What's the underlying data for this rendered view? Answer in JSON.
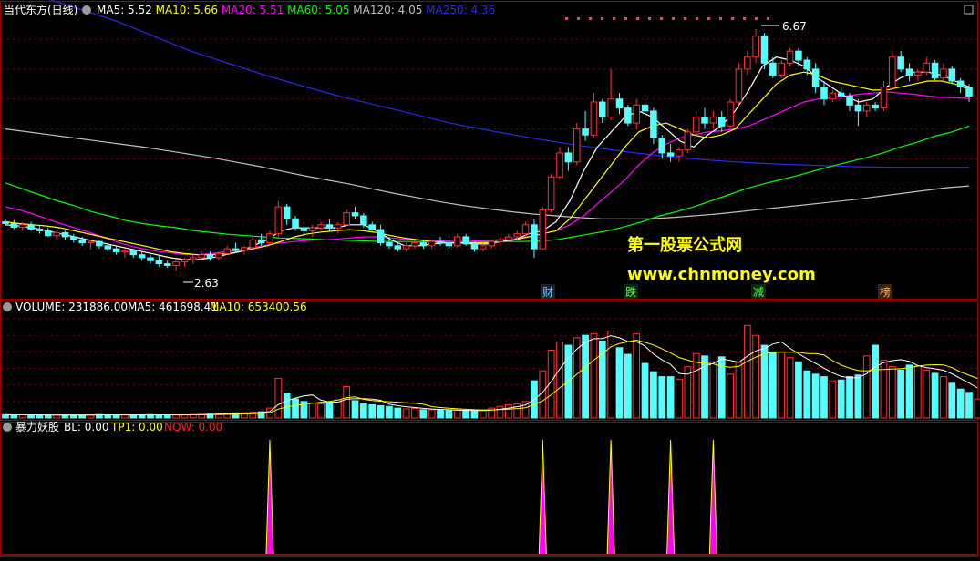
{
  "colors": {
    "up": "#ff3232",
    "down": "#54ffff",
    "ma5": "#ffffff",
    "ma10": "#ffff00",
    "ma20": "#ff00ff",
    "ma60": "#00ff00",
    "ma120": "#c0c0c0",
    "ma250": "#2a2ae6",
    "grid": "#7a0000",
    "border": "#9b0000",
    "watermark": "#ffff00"
  },
  "header": {
    "title": "当代东方(日线)",
    "ma": [
      {
        "label": "MA5: 5.52",
        "color": "#ffffff"
      },
      {
        "label": "MA10: 5.66",
        "color": "#ffff00"
      },
      {
        "label": "MA20: 5.51",
        "color": "#ff00ff"
      },
      {
        "label": "MA60: 5.05",
        "color": "#00ff00"
      },
      {
        "label": "MA120: 4.05",
        "color": "#c0c0c0"
      },
      {
        "label": "MA250: 4.36",
        "color": "#2a2ae6"
      }
    ]
  },
  "annotations": {
    "high": "6.67",
    "low": "2.63",
    "tags": [
      "财",
      "跌",
      "减",
      "榜"
    ]
  },
  "watermark": {
    "line1": "第一股票公式网",
    "line2": "www.chnmoney.com"
  },
  "volume_header": {
    "label": "VOLUME: 231886.00",
    "ma5": "MA5: 461698.41",
    "ma10": "MA10: 653400.56"
  },
  "ind_header": {
    "label": "暴力妖股",
    "bl": "BL: 0.00",
    "tp1": "TP1: 0.00",
    "nqw": "NQW: 0.00"
  },
  "chart_data": [
    {
      "type": "candlestick",
      "title": "当代东方(日线)",
      "ohlc": [
        [
          3.45,
          3.5,
          3.38,
          3.42
        ],
        [
          3.42,
          3.48,
          3.33,
          3.36
        ],
        [
          3.36,
          3.44,
          3.3,
          3.4
        ],
        [
          3.4,
          3.45,
          3.3,
          3.33
        ],
        [
          3.33,
          3.38,
          3.25,
          3.3
        ],
        [
          3.3,
          3.35,
          3.2,
          3.22
        ],
        [
          3.22,
          3.3,
          3.15,
          3.27
        ],
        [
          3.27,
          3.3,
          3.15,
          3.2
        ],
        [
          3.2,
          3.25,
          3.1,
          3.15
        ],
        [
          3.15,
          3.2,
          3.05,
          3.1
        ],
        [
          3.1,
          3.15,
          3.0,
          3.12
        ],
        [
          3.12,
          3.15,
          3.0,
          3.05
        ],
        [
          3.05,
          3.1,
          2.95,
          3.0
        ],
        [
          3.0,
          3.05,
          2.9,
          2.95
        ],
        [
          2.95,
          3.0,
          2.85,
          2.97
        ],
        [
          2.97,
          3.0,
          2.85,
          2.9
        ],
        [
          2.9,
          2.95,
          2.8,
          2.85
        ],
        [
          2.85,
          2.9,
          2.75,
          2.8
        ],
        [
          2.8,
          2.9,
          2.7,
          2.75
        ],
        [
          2.75,
          2.8,
          2.68,
          2.72
        ],
        [
          2.72,
          2.8,
          2.63,
          2.78
        ],
        [
          2.78,
          2.85,
          2.7,
          2.82
        ],
        [
          2.82,
          2.9,
          2.75,
          2.85
        ],
        [
          2.85,
          2.95,
          2.8,
          2.9
        ],
        [
          2.9,
          2.95,
          2.8,
          2.85
        ],
        [
          2.85,
          2.95,
          2.8,
          2.92
        ],
        [
          2.92,
          3.05,
          2.9,
          3.0
        ],
        [
          3.0,
          3.1,
          2.95,
          2.97
        ],
        [
          2.97,
          3.05,
          2.9,
          3.02
        ],
        [
          3.02,
          3.2,
          3.0,
          3.15
        ],
        [
          3.15,
          3.25,
          3.05,
          3.1
        ],
        [
          3.1,
          3.3,
          3.08,
          3.25
        ],
        [
          3.25,
          3.8,
          3.2,
          3.7
        ],
        [
          3.7,
          3.75,
          3.4,
          3.5
        ],
        [
          3.5,
          3.55,
          3.3,
          3.35
        ],
        [
          3.35,
          3.45,
          3.25,
          3.3
        ],
        [
          3.3,
          3.4,
          3.2,
          3.35
        ],
        [
          3.35,
          3.45,
          3.3,
          3.4
        ],
        [
          3.4,
          3.5,
          3.3,
          3.35
        ],
        [
          3.35,
          3.45,
          3.25,
          3.4
        ],
        [
          3.4,
          3.65,
          3.38,
          3.6
        ],
        [
          3.6,
          3.7,
          3.5,
          3.55
        ],
        [
          3.55,
          3.6,
          3.35,
          3.4
        ],
        [
          3.4,
          3.45,
          3.3,
          3.32
        ],
        [
          3.32,
          3.4,
          3.05,
          3.1
        ],
        [
          3.1,
          3.2,
          3.0,
          3.05
        ],
        [
          3.05,
          3.1,
          2.95,
          3.0
        ],
        [
          3.0,
          3.1,
          2.95,
          3.05
        ],
        [
          3.05,
          3.15,
          3.0,
          3.1
        ],
        [
          3.1,
          3.15,
          3.0,
          3.05
        ],
        [
          3.05,
          3.15,
          3.0,
          3.12
        ],
        [
          3.12,
          3.2,
          3.05,
          3.1
        ],
        [
          3.1,
          3.15,
          3.0,
          3.05
        ],
        [
          3.05,
          3.25,
          3.02,
          3.2
        ],
        [
          3.2,
          3.25,
          3.05,
          3.08
        ],
        [
          3.08,
          3.12,
          2.95,
          3.0
        ],
        [
          3.0,
          3.1,
          2.95,
          3.05
        ],
        [
          3.05,
          3.15,
          3.0,
          3.12
        ],
        [
          3.12,
          3.2,
          3.05,
          3.15
        ],
        [
          3.15,
          3.25,
          3.1,
          3.2
        ],
        [
          3.2,
          3.3,
          3.15,
          3.25
        ],
        [
          3.25,
          3.45,
          3.2,
          3.4
        ],
        [
          3.4,
          3.5,
          2.85,
          3.0
        ],
        [
          3.0,
          3.7,
          2.98,
          3.65
        ],
        [
          3.65,
          4.25,
          3.6,
          4.2
        ],
        [
          4.2,
          4.7,
          4.15,
          4.6
        ],
        [
          4.6,
          4.7,
          4.3,
          4.45
        ],
        [
          4.45,
          5.1,
          4.4,
          5.0
        ],
        [
          5.0,
          5.3,
          4.8,
          4.9
        ],
        [
          4.9,
          5.6,
          4.85,
          5.45
        ],
        [
          5.45,
          5.5,
          5.1,
          5.2
        ],
        [
          5.2,
          6.0,
          5.15,
          5.5
        ],
        [
          5.5,
          5.6,
          5.25,
          5.35
        ],
        [
          5.35,
          5.4,
          5.05,
          5.1
        ],
        [
          5.1,
          5.5,
          5.0,
          5.4
        ],
        [
          5.4,
          5.5,
          5.2,
          5.3
        ],
        [
          5.3,
          5.35,
          4.75,
          4.85
        ],
        [
          4.85,
          4.9,
          4.5,
          4.6
        ],
        [
          4.6,
          4.75,
          4.45,
          4.55
        ],
        [
          4.55,
          4.7,
          4.45,
          4.65
        ],
        [
          4.65,
          5.0,
          4.6,
          4.95
        ],
        [
          4.95,
          5.3,
          4.9,
          5.2
        ],
        [
          5.2,
          5.35,
          5.0,
          5.1
        ],
        [
          5.1,
          5.3,
          5.0,
          5.2
        ],
        [
          5.2,
          5.3,
          4.95,
          5.05
        ],
        [
          5.05,
          5.5,
          5.0,
          5.45
        ],
        [
          5.45,
          6.1,
          5.4,
          6.0
        ],
        [
          6.0,
          6.3,
          5.9,
          6.2
        ],
        [
          6.2,
          6.67,
          6.1,
          6.55
        ],
        [
          6.55,
          6.6,
          6.0,
          6.1
        ],
        [
          6.1,
          6.2,
          5.85,
          5.9
        ],
        [
          5.9,
          6.15,
          5.85,
          6.1
        ],
        [
          6.1,
          6.35,
          6.05,
          6.3
        ],
        [
          6.3,
          6.35,
          6.05,
          6.15
        ],
        [
          6.15,
          6.2,
          5.9,
          6.0
        ],
        [
          6.0,
          6.1,
          5.6,
          5.7
        ],
        [
          5.7,
          5.8,
          5.4,
          5.5
        ],
        [
          5.5,
          5.65,
          5.45,
          5.6
        ],
        [
          5.6,
          5.7,
          5.5,
          5.55
        ],
        [
          5.55,
          5.6,
          5.3,
          5.4
        ],
        [
          5.4,
          5.5,
          5.05,
          5.3
        ],
        [
          5.3,
          5.45,
          5.2,
          5.4
        ],
        [
          5.4,
          5.45,
          5.3,
          5.35
        ],
        [
          5.35,
          5.8,
          5.3,
          5.7
        ],
        [
          5.7,
          6.3,
          5.65,
          6.2
        ],
        [
          6.2,
          6.3,
          5.95,
          6.0
        ],
        [
          6.0,
          6.1,
          5.8,
          5.9
        ],
        [
          5.9,
          6.0,
          5.8,
          5.95
        ],
        [
          5.95,
          6.2,
          5.9,
          6.1
        ],
        [
          6.1,
          6.15,
          5.8,
          5.85
        ],
        [
          5.85,
          6.1,
          5.8,
          6.0
        ],
        [
          6.0,
          6.05,
          5.75,
          5.8
        ],
        [
          5.8,
          5.85,
          5.6,
          5.7
        ],
        [
          5.7,
          5.75,
          5.45,
          5.55
        ]
      ],
      "y_ticks": [
        3.0,
        3.5,
        4.0,
        4.5,
        5.0,
        5.5,
        6.0,
        6.5
      ],
      "high_label": "6.67",
      "low_label": "2.63",
      "ma": {
        "MA5": [
          3.4,
          3.38,
          3.35,
          3.3,
          3.25,
          3.2,
          3.15,
          3.1,
          3.05,
          3.0,
          2.95,
          2.9,
          2.85,
          2.82,
          2.82,
          2.85,
          2.9,
          2.95,
          3.05,
          3.15,
          3.3,
          3.35,
          3.35,
          3.35,
          3.35,
          3.4,
          3.4,
          3.3,
          3.15,
          3.05,
          3.05,
          3.08,
          3.1,
          3.1,
          3.08,
          3.08,
          3.12,
          3.15,
          3.25,
          3.3,
          3.45,
          3.8,
          4.3,
          4.7,
          4.95,
          5.2,
          5.3,
          5.2,
          5.0,
          4.8,
          4.7,
          4.9,
          5.05,
          5.3,
          5.65,
          6.05,
          6.2,
          6.15,
          6.05,
          5.85,
          5.7,
          5.55,
          5.45,
          5.5,
          5.7,
          5.85,
          5.95,
          5.95,
          5.9,
          5.8,
          5.7
        ],
        "MA10": [
          3.45,
          3.42,
          3.4,
          3.38,
          3.35,
          3.3,
          3.25,
          3.2,
          3.15,
          3.1,
          3.05,
          3.0,
          2.95,
          2.92,
          2.9,
          2.9,
          2.92,
          2.95,
          3.0,
          3.05,
          3.12,
          3.2,
          3.25,
          3.28,
          3.3,
          3.32,
          3.3,
          3.27,
          3.22,
          3.18,
          3.15,
          3.12,
          3.1,
          3.1,
          3.1,
          3.1,
          3.12,
          3.15,
          3.2,
          3.25,
          3.3,
          3.5,
          3.8,
          4.1,
          4.4,
          4.7,
          4.95,
          5.05,
          5.1,
          5.0,
          4.9,
          4.85,
          4.9,
          5.0,
          5.25,
          5.5,
          5.75,
          5.9,
          5.95,
          5.9,
          5.8,
          5.75,
          5.7,
          5.65,
          5.65,
          5.7,
          5.75,
          5.8,
          5.8,
          5.75,
          5.66
        ],
        "MA20": [
          3.7,
          3.65,
          3.58,
          3.5,
          3.42,
          3.35,
          3.28,
          3.2,
          3.12,
          3.05,
          3.0,
          2.96,
          2.93,
          2.9,
          2.9,
          2.92,
          2.95,
          2.98,
          3.02,
          3.06,
          3.1,
          3.12,
          3.14,
          3.15,
          3.16,
          3.18,
          3.2,
          3.2,
          3.18,
          3.16,
          3.15,
          3.14,
          3.13,
          3.12,
          3.13,
          3.14,
          3.15,
          3.17,
          3.2,
          3.25,
          3.3,
          3.4,
          3.55,
          3.75,
          3.95,
          4.15,
          4.4,
          4.6,
          4.75,
          4.85,
          4.9,
          4.95,
          4.97,
          5.0,
          5.05,
          5.15,
          5.25,
          5.35,
          5.45,
          5.5,
          5.52,
          5.55,
          5.58,
          5.6,
          5.62,
          5.6,
          5.58,
          5.55,
          5.53,
          5.52,
          5.51
        ],
        "MA60": [
          4.1,
          4.0,
          3.9,
          3.8,
          3.72,
          3.62,
          3.55,
          3.47,
          3.42,
          3.38,
          3.35,
          3.3,
          3.27,
          3.24,
          3.22,
          3.2,
          3.18,
          3.17,
          3.16,
          3.15,
          3.14,
          3.13,
          3.12,
          3.12,
          3.12,
          3.12,
          3.12,
          3.12,
          3.12,
          3.12,
          3.12,
          3.13,
          3.15,
          3.2,
          3.25,
          3.3,
          3.37,
          3.45,
          3.55,
          3.62,
          3.7,
          3.8,
          3.9,
          4.0,
          4.08,
          4.15,
          4.22,
          4.3,
          4.38,
          4.45,
          4.52,
          4.6,
          4.7,
          4.78,
          4.88,
          4.95,
          5.05
        ],
        "MA120": [
          5.0,
          4.95,
          4.9,
          4.85,
          4.8,
          4.75,
          4.7,
          4.64,
          4.58,
          4.52,
          4.45,
          4.38,
          4.3,
          4.22,
          4.15,
          4.08,
          4.0,
          3.92,
          3.85,
          3.78,
          3.72,
          3.67,
          3.62,
          3.58,
          3.55,
          3.52,
          3.5,
          3.5,
          3.5,
          3.52,
          3.55,
          3.58,
          3.62,
          3.66,
          3.7,
          3.74,
          3.78,
          3.82,
          3.87,
          3.92,
          3.97,
          4.02,
          4.05
        ],
        "MA250": [
          7.4,
          7.2,
          7.0,
          6.8,
          6.55,
          6.3,
          6.1,
          5.9,
          5.72,
          5.55,
          5.4,
          5.25,
          5.1,
          4.98,
          4.87,
          4.77,
          4.68,
          4.6,
          4.53,
          4.48,
          4.44,
          4.41,
          4.39,
          4.37,
          4.36,
          4.36,
          4.36
        ]
      }
    },
    {
      "type": "bar",
      "title": "VOLUME",
      "y_ticks": [
        200000,
        400000,
        600000,
        800000,
        1000000,
        1200000
      ],
      "values": [
        40000,
        38000,
        39000,
        35000,
        37000,
        36000,
        34000,
        38000,
        35000,
        36000,
        40000,
        42000,
        38000,
        35000,
        37000,
        36000,
        39000,
        41000,
        38000,
        37000,
        36000,
        40000,
        42000,
        45000,
        48000,
        55000,
        60000,
        62000,
        65000,
        70000,
        75000,
        120000,
        480000,
        300000,
        230000,
        200000,
        180000,
        170000,
        190000,
        220000,
        380000,
        210000,
        175000,
        160000,
        150000,
        140000,
        120000,
        110000,
        115000,
        100000,
        100000,
        95000,
        90000,
        95000,
        88000,
        90000,
        92000,
        120000,
        140000,
        160000,
        170000,
        200000,
        450000,
        570000,
        820000,
        920000,
        880000,
        970000,
        1000000,
        1020000,
        930000,
        1050000,
        850000,
        770000,
        1020000,
        660000,
        560000,
        500000,
        500000,
        470000,
        620000,
        780000,
        750000,
        680000,
        740000,
        530000,
        670000,
        1120000,
        1000000,
        880000,
        800000,
        800000,
        730000,
        680000,
        570000,
        530000,
        500000,
        450000,
        460000,
        500000,
        520000,
        750000,
        880000,
        700000,
        620000,
        580000,
        640000,
        630000,
        580000,
        540000,
        500000,
        420000,
        350000,
        310000,
        230000
      ],
      "ma5_label": "MA5: 461698.41",
      "ma10_label": "MA10: 653400.56"
    },
    {
      "type": "line",
      "title": "暴力妖股",
      "spikes_at": [
        31,
        63,
        71,
        78,
        83
      ],
      "series": [
        {
          "name": "BL",
          "value": 0.0
        },
        {
          "name": "TP1",
          "value": 0.0
        },
        {
          "name": "NQW",
          "value": 0.0
        }
      ]
    }
  ]
}
